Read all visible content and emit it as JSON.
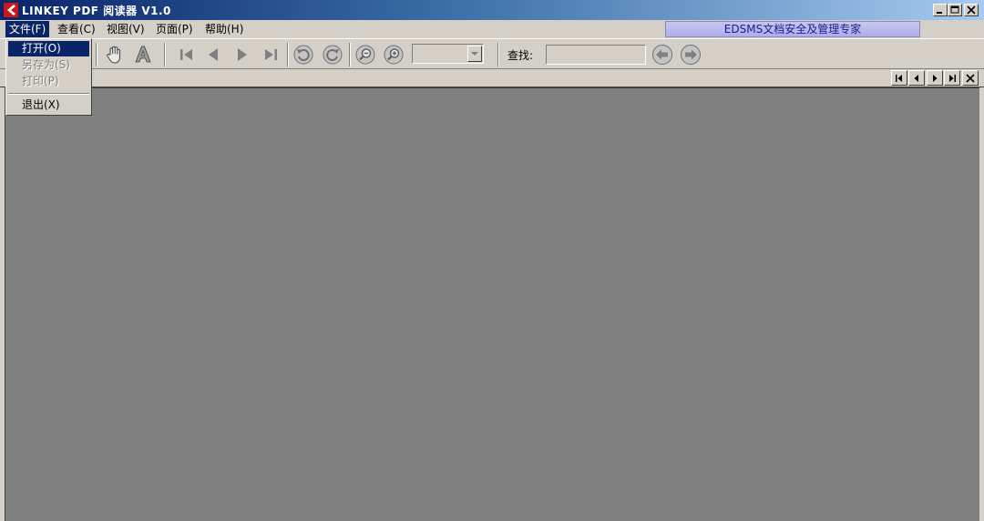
{
  "window": {
    "title": "LINKEY PDF 阅读器 V1.0",
    "buttons": [
      "minimize-icon",
      "maximize-icon",
      "close-icon"
    ]
  },
  "menubar": {
    "items": [
      {
        "label": "文件(F)"
      },
      {
        "label": "查看(C)"
      },
      {
        "label": "视图(V)"
      },
      {
        "label": "页面(P)"
      },
      {
        "label": "帮助(H)"
      }
    ],
    "promo": "EDSMS文档安全及管理专家"
  },
  "file_menu": {
    "items": [
      {
        "label": "打开(O)",
        "state": "highlighted"
      },
      {
        "label": "另存为(S)",
        "state": "disabled"
      },
      {
        "label": "打印(P)",
        "state": "disabled"
      },
      {
        "label": "退出(X)",
        "state": "normal"
      }
    ]
  },
  "toolbar": {
    "icons": [
      "hand-tool-icon",
      "text-select-icon",
      "first-page-icon",
      "prev-page-icon",
      "next-page-icon",
      "last-page-icon",
      "rotate-left-icon",
      "rotate-right-icon",
      "zoom-out-icon",
      "zoom-in-icon"
    ],
    "zoom_value": "",
    "find_label": "查找:",
    "find_value": "",
    "find_icons": [
      "find-prev-icon",
      "find-next-icon"
    ]
  },
  "nav_strip": {
    "icons": [
      "nav-first-icon",
      "nav-prev-icon",
      "nav-next-icon",
      "nav-last-icon",
      "nav-close-icon"
    ]
  },
  "colors": {
    "title_gradient_start": "#0a246a",
    "title_gradient_end": "#a6caf0",
    "face": "#d4d0c8",
    "document_bg": "#808080",
    "menu_highlight": "#0a246a",
    "promo_bg": "#b8b7ec",
    "promo_text": "#1a1a8c"
  }
}
